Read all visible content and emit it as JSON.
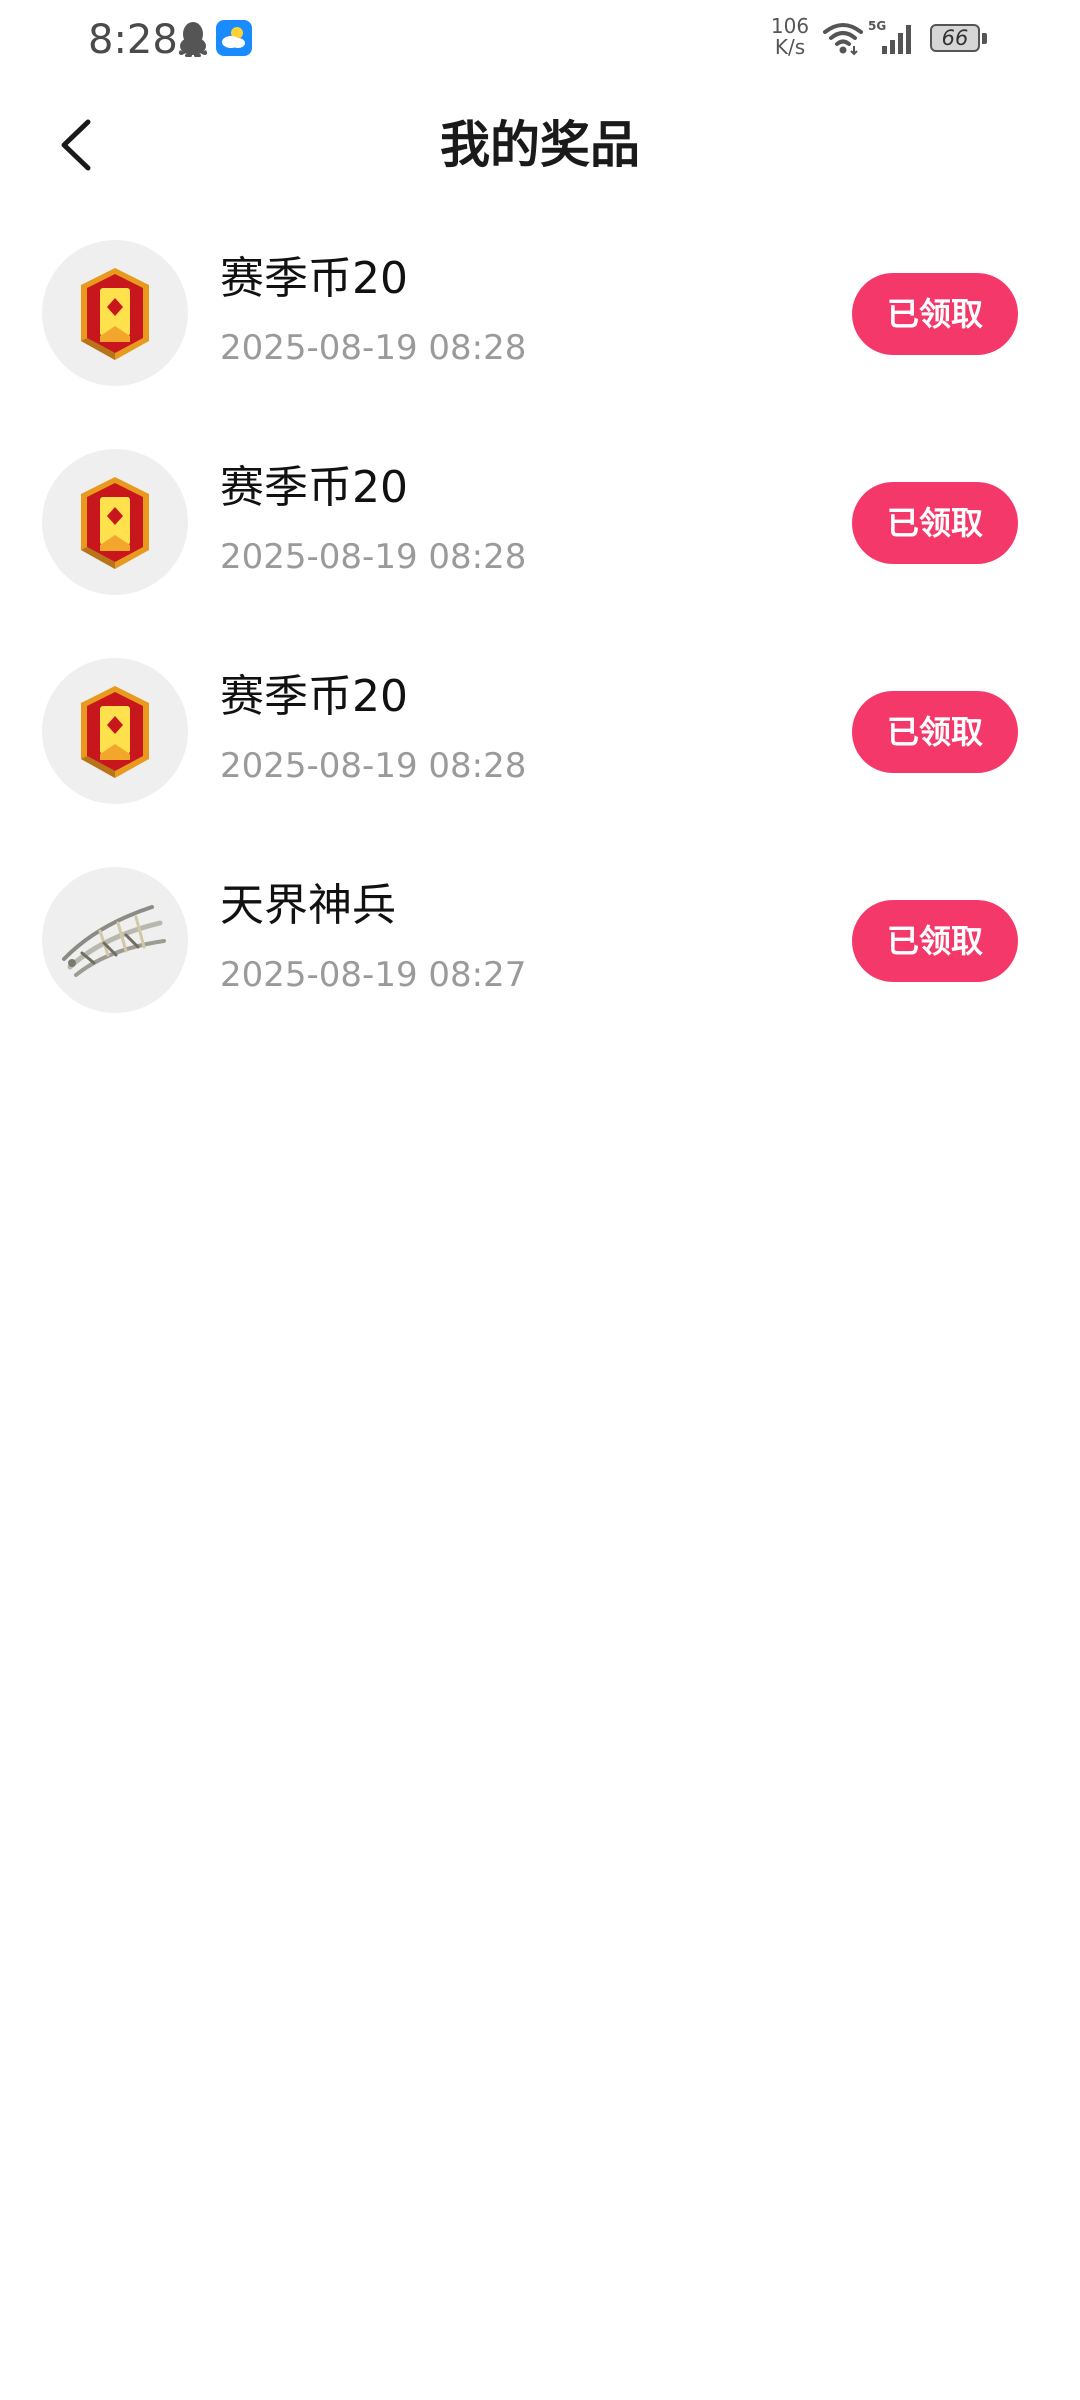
{
  "status_bar": {
    "time": "8:28",
    "net_speed_value": "106",
    "net_speed_unit": "K/s",
    "network_type": "5G",
    "battery_level": "66",
    "icons": [
      "qq-icon",
      "weather-icon",
      "wifi-icon",
      "signal-icon",
      "battery-icon"
    ]
  },
  "header": {
    "title": "我的奖品",
    "back_icon": "chevron-left-icon"
  },
  "colors": {
    "accent": "#f5386a",
    "date_text": "#9a9a9a",
    "thumb_background": "#efefef"
  },
  "prizes": [
    {
      "name": "赛季币20",
      "date": "2025-08-19 08:28",
      "button_label": "已领取",
      "icon": "season-coin-badge-icon"
    },
    {
      "name": "赛季币20",
      "date": "2025-08-19 08:28",
      "button_label": "已领取",
      "icon": "season-coin-badge-icon"
    },
    {
      "name": "赛季币20",
      "date": "2025-08-19 08:28",
      "button_label": "已领取",
      "icon": "season-coin-badge-icon"
    },
    {
      "name": "天界神兵",
      "date": "2025-08-19 08:27",
      "button_label": "已领取",
      "icon": "divine-weapon-icon"
    }
  ]
}
